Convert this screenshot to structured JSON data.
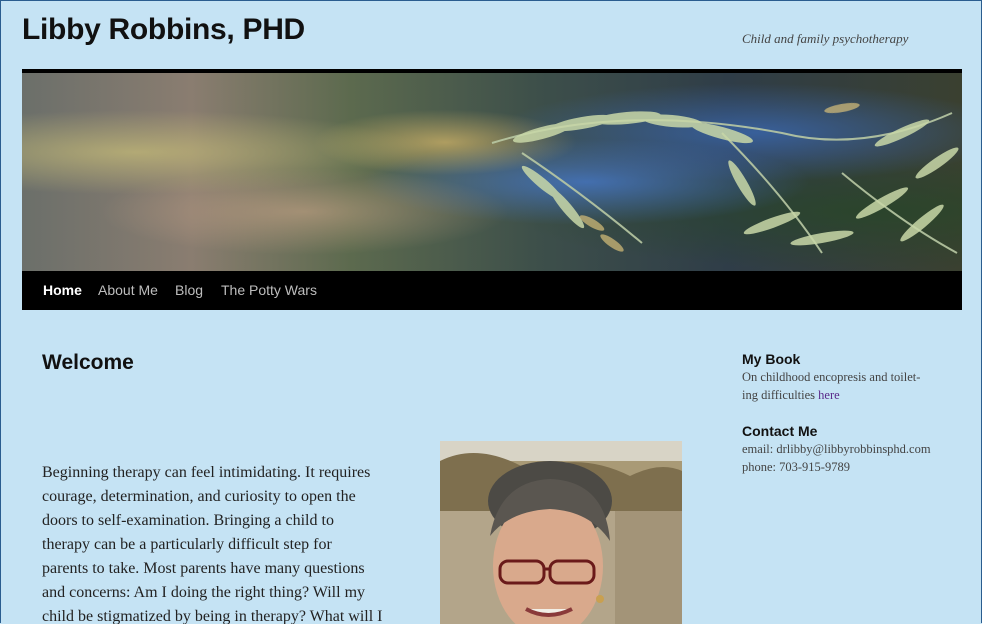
{
  "site": {
    "title": "Libby Robbins, PHD",
    "tagline": "Child and family psychotherapy"
  },
  "nav": {
    "items": [
      {
        "label": "Home",
        "active": true
      },
      {
        "label": "About Me",
        "active": false
      },
      {
        "label": "Blog",
        "active": false
      },
      {
        "label": "The Potty Wars",
        "active": false
      }
    ]
  },
  "content": {
    "title": "Welcome",
    "paragraph_lines": [
      "Beginning therapy can feel intimidating. It requires",
      "courage, determination, and curiosity to open the",
      "doors to self-examination. Bringing a child to",
      "therapy can be a particularly difficult step for",
      "parents to take. Most parents have many questions",
      "and concerns: Am I doing the right thing? Will my",
      "child be stigmatized by being in therapy? What will I"
    ]
  },
  "sidebar": {
    "book": {
      "title": "My Book",
      "line1": "On childhood encopresis and toilet-",
      "line2_prefix": "ing difficulties ",
      "link_text": "here"
    },
    "contact": {
      "title": "Contact Me",
      "email_line": "email: drlibby@libbyrobbinsphd.com",
      "phone_line": "phone: 703-915-9789"
    }
  },
  "colors": {
    "background": "#c5e3f4",
    "navbar": "#000000",
    "link": "#5a2a8a"
  }
}
